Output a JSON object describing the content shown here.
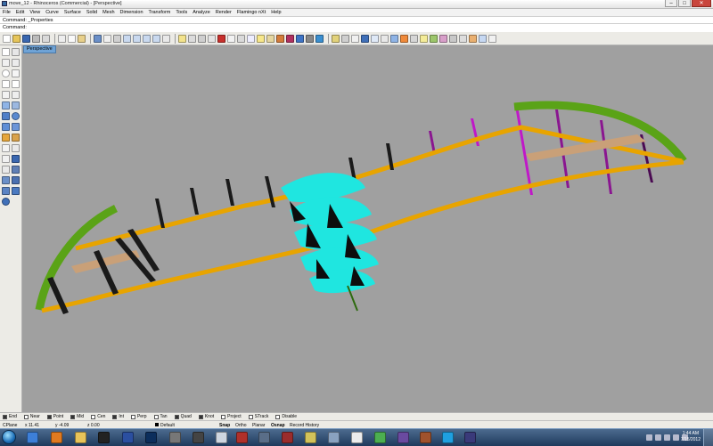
{
  "window": {
    "title": "move_12 - Rhinoceros (Commercial) - [Perspective]",
    "buttons": [
      "–",
      "□",
      "✕"
    ]
  },
  "menu": [
    "File",
    "Edit",
    "View",
    "Curve",
    "Surface",
    "Solid",
    "Mesh",
    "Dimension",
    "Transform",
    "Tools",
    "Analyze",
    "Render",
    "Flamingo nXt",
    "Help"
  ],
  "command": {
    "history": "Command: _Properties",
    "prompt": "Command:"
  },
  "viewport": {
    "label": "Perspective"
  },
  "osnap": [
    {
      "label": "End",
      "checked": true
    },
    {
      "label": "Near",
      "checked": false
    },
    {
      "label": "Point",
      "checked": true
    },
    {
      "label": "Mid",
      "checked": true
    },
    {
      "label": "Cen",
      "checked": false
    },
    {
      "label": "Int",
      "checked": true
    },
    {
      "label": "Perp",
      "checked": false
    },
    {
      "label": "Tan",
      "checked": false
    },
    {
      "label": "Quad",
      "checked": true
    },
    {
      "label": "Knot",
      "checked": true
    },
    {
      "label": "Project",
      "checked": false
    },
    {
      "label": "STrack",
      "checked": false
    },
    {
      "label": "Disable",
      "checked": false
    }
  ],
  "status": {
    "cplane": "CPlane",
    "x": "x 11.41",
    "y": "y -4.09",
    "z": "z 0.00",
    "layer": "Default",
    "snap": "Snap",
    "ortho": "Ortho",
    "planar": "Planar",
    "osnap": "Osnap",
    "history": "Record History"
  },
  "clock": {
    "time": "1:44 AM",
    "date": "7/15/2012"
  },
  "colors": {
    "beam": "#e8a400",
    "green": "#5aa317",
    "cyan": "#1fe6e0",
    "magenta": "#c018c8",
    "viewport_bg": "#a0a0a0"
  }
}
